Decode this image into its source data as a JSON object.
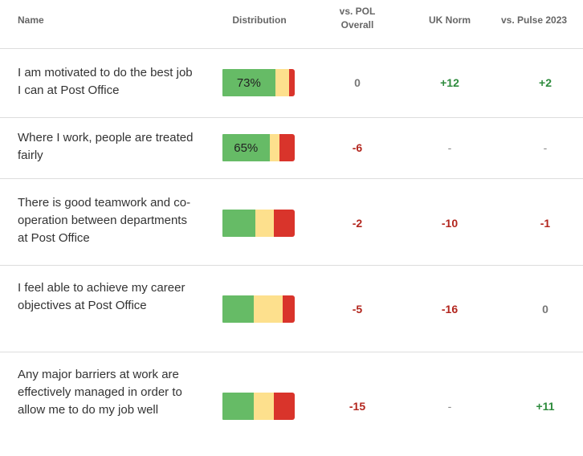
{
  "columns": {
    "name": "Name",
    "distribution": "Distribution",
    "vs_pol_line1": "vs. POL",
    "vs_pol_line2": "Overall",
    "uk_norm": "UK Norm",
    "vs_pulse": "vs. Pulse 2023"
  },
  "colors": {
    "favourable": "#66bb66",
    "neutral": "#fde08d",
    "unfavourable": "#d9342b",
    "negative_text": "#b3261e",
    "positive_text": "#2e8b3d"
  },
  "rows": [
    {
      "question": "I am motivated to do the best job I can at Post Office",
      "distribution": {
        "favourable_label": "73%",
        "favourable": 73,
        "neutral": 19,
        "unfavourable": 8
      },
      "vs_pol": "0",
      "uk_norm": "+12",
      "vs_pulse": "+2"
    },
    {
      "question": "Where I work, people are treated fairly",
      "distribution": {
        "favourable_label": "65%",
        "favourable": 65,
        "neutral": 14,
        "unfavourable": 21
      },
      "vs_pol": "-6",
      "uk_norm": "-",
      "vs_pulse": "-"
    },
    {
      "question": "There is good teamwork and co-operation between departments at Post Office",
      "distribution": {
        "favourable_label": "",
        "favourable": 45,
        "neutral": 26,
        "unfavourable": 29
      },
      "vs_pol": "-2",
      "uk_norm": "-10",
      "vs_pulse": "-1"
    },
    {
      "question": "I feel able to achieve my career objectives at Post Office",
      "distribution": {
        "favourable_label": "",
        "favourable": 43,
        "neutral": 40,
        "unfavourable": 17
      },
      "vs_pol": "-5",
      "uk_norm": "-16",
      "vs_pulse": "0"
    },
    {
      "question": "Any major barriers at work are effectively managed in order to allow me to do my job well",
      "distribution": {
        "favourable_label": "",
        "favourable": 43,
        "neutral": 28,
        "unfavourable": 29
      },
      "vs_pol": "-15",
      "uk_norm": "-",
      "vs_pulse": "+11"
    }
  ]
}
